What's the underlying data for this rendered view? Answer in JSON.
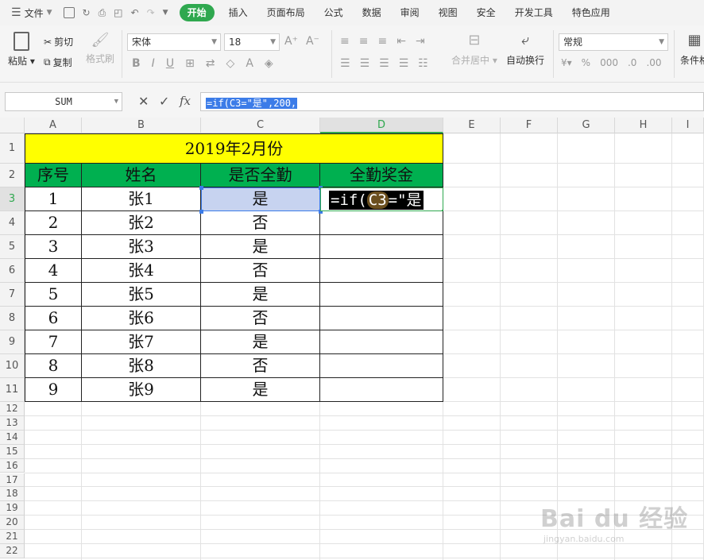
{
  "menu": {
    "file_label": "文件",
    "tabs": [
      {
        "label": "开始",
        "active": true
      },
      {
        "label": "插入"
      },
      {
        "label": "页面布局"
      },
      {
        "label": "公式"
      },
      {
        "label": "数据"
      },
      {
        "label": "审阅"
      },
      {
        "label": "视图"
      },
      {
        "label": "安全"
      },
      {
        "label": "开发工具"
      },
      {
        "label": "特色应用"
      }
    ]
  },
  "ribbon": {
    "paste_label": "粘贴",
    "cut_label": "剪切",
    "copy_label": "复制",
    "format_painter_label": "格式刷",
    "font_name": "宋体",
    "font_size": "18",
    "merge_center_label": "合并居中",
    "wrap_text_label": "自动换行",
    "number_format": "常规",
    "conditional_label": "条件格"
  },
  "formula_bar": {
    "name_box": "SUM",
    "formula": "=if(C3=\"是\",200,"
  },
  "columns": [
    "A",
    "B",
    "C",
    "D",
    "E",
    "F",
    "G",
    "H",
    "I"
  ],
  "rows": [
    "1",
    "2",
    "3",
    "4",
    "5",
    "6",
    "7",
    "8",
    "9",
    "10",
    "11",
    "12",
    "13",
    "14",
    "15",
    "16",
    "17",
    "18",
    "19",
    "20",
    "21",
    "22"
  ],
  "sheet": {
    "title": "2019年2月份",
    "headers": [
      "序号",
      "姓名",
      "是否全勤",
      "全勤奖金"
    ],
    "data": [
      [
        "1",
        "张1",
        "是"
      ],
      [
        "2",
        "张2",
        "否"
      ],
      [
        "3",
        "张3",
        "是"
      ],
      [
        "4",
        "张4",
        "否"
      ],
      [
        "5",
        "张5",
        "是"
      ],
      [
        "6",
        "张6",
        "否"
      ],
      [
        "7",
        "张7",
        "是"
      ],
      [
        "8",
        "张8",
        "否"
      ],
      [
        "9",
        "张9",
        "是"
      ]
    ],
    "editing_cell_text_pre": "=if(",
    "editing_cell_ref": "C3",
    "editing_cell_text_post": "=\"是"
  },
  "watermark": {
    "brand": "Bai du 经验",
    "url": "jingyan.baidu.com"
  },
  "colors": {
    "accent": "#2fa84f",
    "title_fill": "#ffff00",
    "header_fill": "#00b050",
    "ref_highlight": "#c7d3f0"
  }
}
